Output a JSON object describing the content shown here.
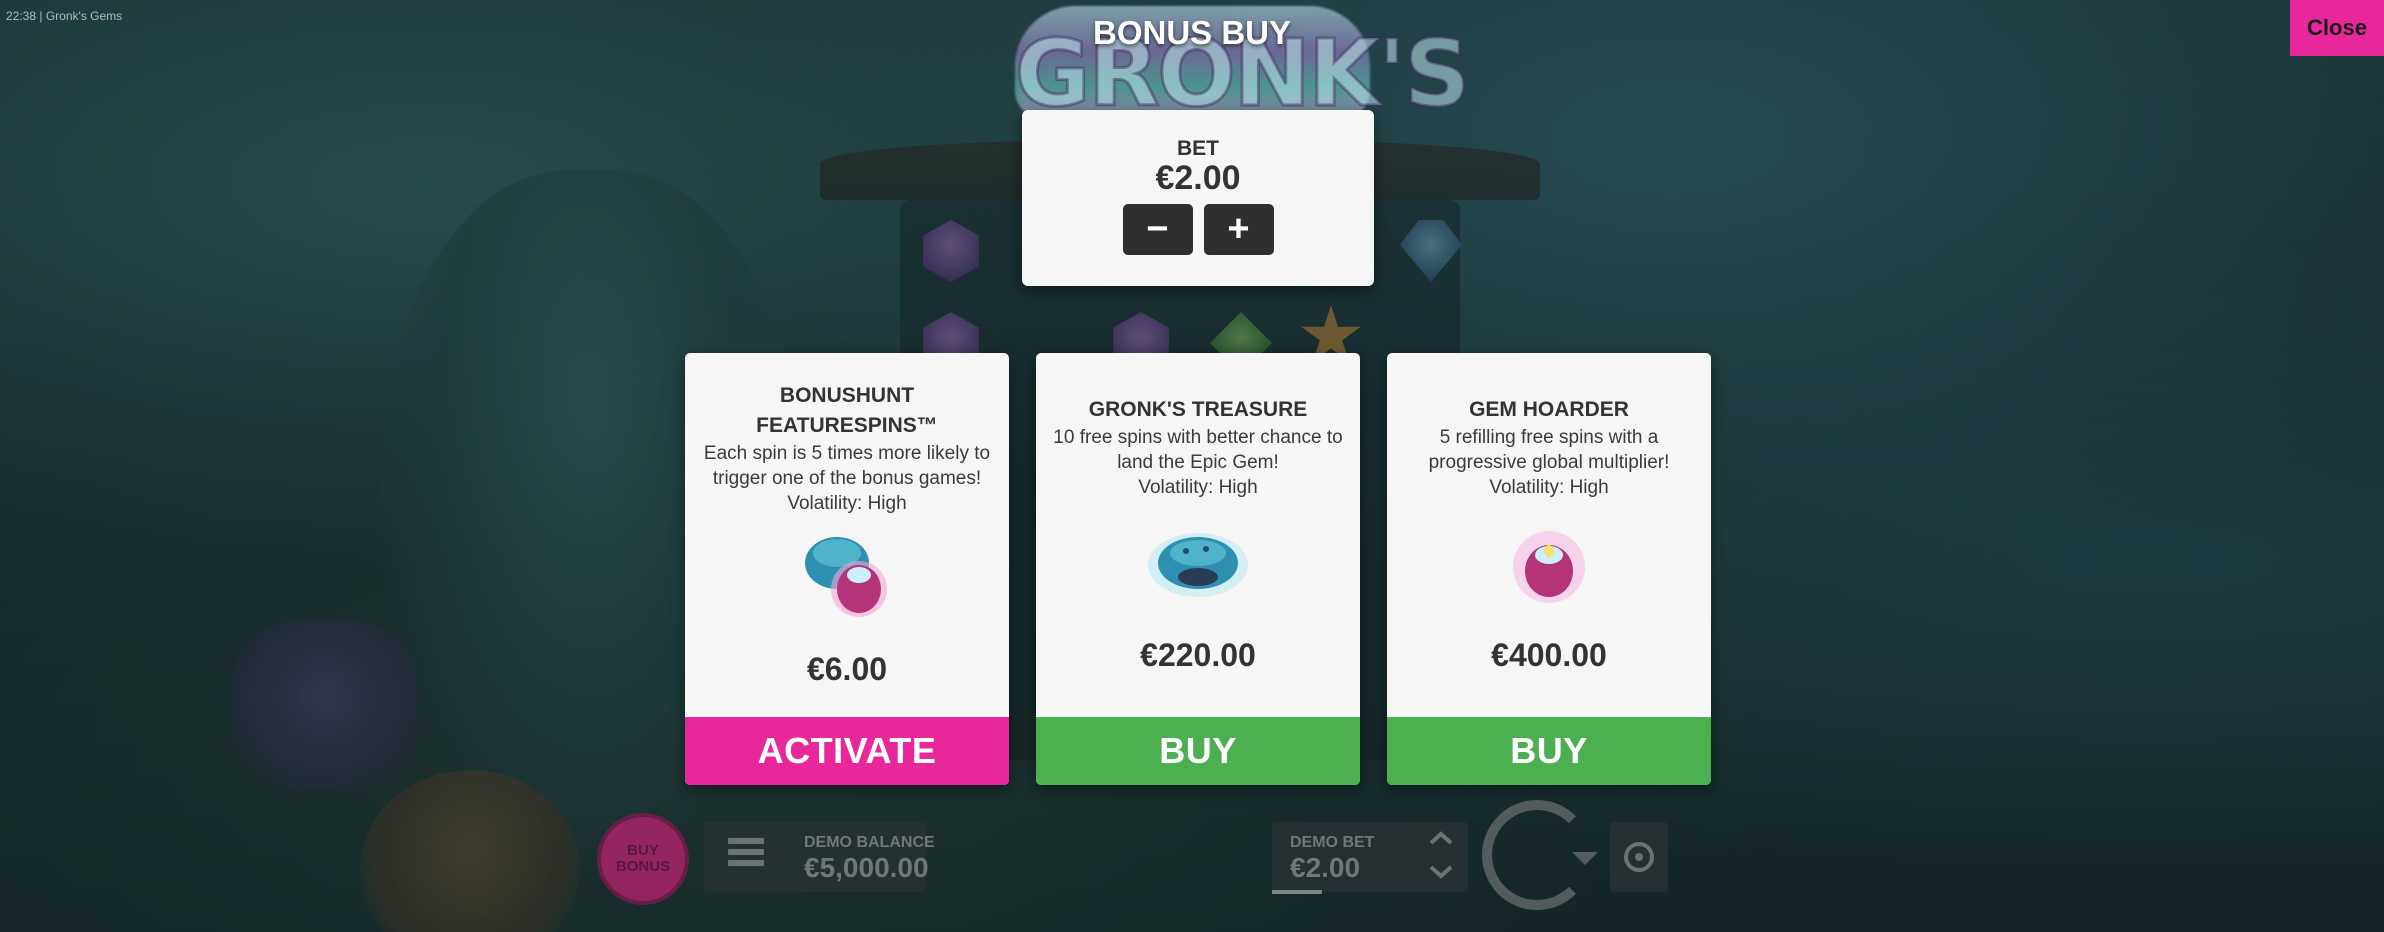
{
  "status_bar": {
    "time": "22:38",
    "separator": "|",
    "game_name": "Gronk's Gems"
  },
  "logo": {
    "word": "GRONK'S"
  },
  "modal": {
    "title": "BONUS BUY",
    "close_label": "Close"
  },
  "bet": {
    "label": "BET",
    "value": "€2.00",
    "decrease_label": "−",
    "increase_label": "+"
  },
  "offers": [
    {
      "title": "BONUSHUNT FEATURESPINS™",
      "description": "Each spin is 5 times more likely to trigger one of the bonus games!",
      "volatility": "Volatility: High",
      "icon": "gronk-and-sack-icon",
      "price": "€6.00",
      "action_label": "ACTIVATE",
      "action_color": "#e8289a"
    },
    {
      "title": "GRONK'S TREASURE",
      "description": "10 free spins with better chance to land the Epic Gem!",
      "volatility": "Volatility: High",
      "icon": "gronk-head-icon",
      "price": "€220.00",
      "action_label": "BUY",
      "action_color": "#4caf50"
    },
    {
      "title": "GEM HOARDER",
      "description": "5 refilling free spins with a progressive global multiplier!",
      "volatility": "Volatility: High",
      "icon": "gem-sack-icon",
      "price": "€400.00",
      "action_label": "BUY",
      "action_color": "#4caf50"
    }
  ],
  "hud": {
    "buy_bonus_label": "BUY BONUS",
    "balance_label": "DEMO BALANCE",
    "balance_value": "€5,000.00",
    "bet_label": "DEMO BET",
    "bet_value": "€2.00"
  }
}
